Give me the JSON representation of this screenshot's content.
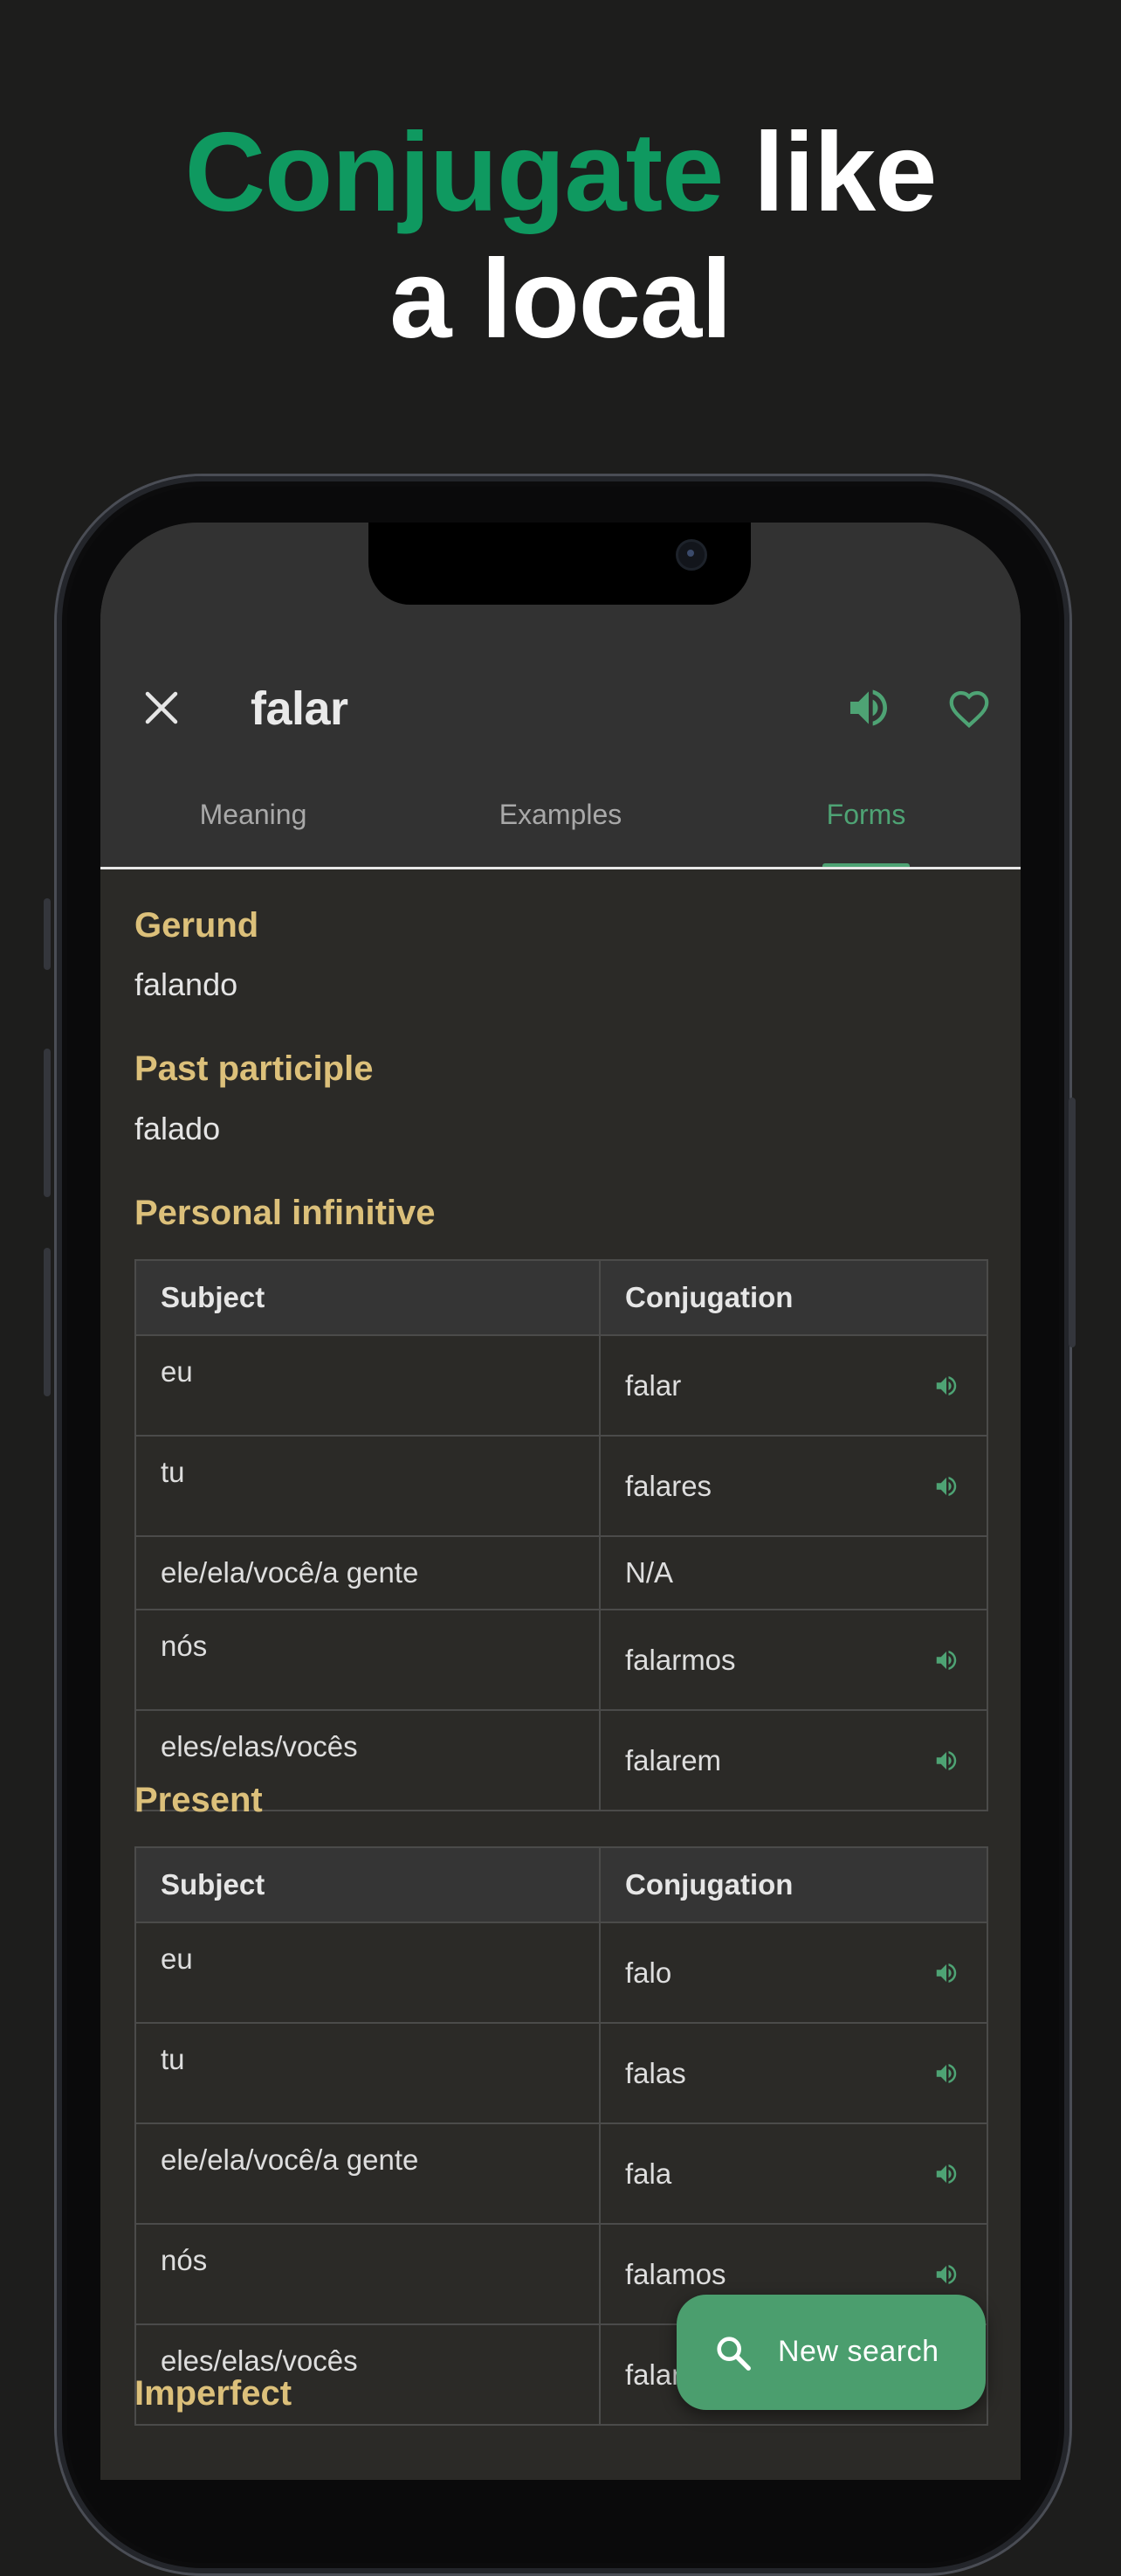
{
  "headline": {
    "accent": "Conjugate",
    "rest_line1": " like",
    "line2": "a local"
  },
  "colors": {
    "accent": "#0f9960",
    "section_title": "#dcc07a",
    "active_tab": "#4ea374",
    "fab": "#4b9e6e"
  },
  "header": {
    "word": "falar",
    "close_icon": "close-icon",
    "sound_icon": "speaker-icon",
    "favorite_icon": "heart-icon"
  },
  "tabs": [
    {
      "label": "Meaning",
      "active": false
    },
    {
      "label": "Examples",
      "active": false
    },
    {
      "label": "Forms",
      "active": true
    }
  ],
  "gerund": {
    "title": "Gerund",
    "value": "falando"
  },
  "past_participle": {
    "title": "Past participle",
    "value": "falado"
  },
  "personal_infinitive": {
    "title": "Personal infinitive",
    "headers": [
      "Subject",
      "Conjugation"
    ],
    "rows": [
      {
        "subject": "eu",
        "form": "falar",
        "audio": true
      },
      {
        "subject": "tu",
        "form": "falares",
        "audio": true
      },
      {
        "subject": "ele/ela/você/a gente",
        "form": "N/A",
        "audio": false
      },
      {
        "subject": "nós",
        "form": "falarmos",
        "audio": true
      },
      {
        "subject": "eles/elas/vocês",
        "form": "falarem",
        "audio": true
      }
    ]
  },
  "present": {
    "title": "Present",
    "headers": [
      "Subject",
      "Conjugation"
    ],
    "rows": [
      {
        "subject": "eu",
        "form": "falo",
        "audio": true
      },
      {
        "subject": "tu",
        "form": "falas",
        "audio": true
      },
      {
        "subject": "ele/ela/você/a gente",
        "form": "fala",
        "audio": true
      },
      {
        "subject": "nós",
        "form": "falamos",
        "audio": true
      },
      {
        "subject": "eles/elas/vocês",
        "form": "falam",
        "audio": true
      }
    ]
  },
  "imperfect": {
    "title": "Imperfect"
  },
  "fab": {
    "label": "New search",
    "icon": "search-icon"
  }
}
